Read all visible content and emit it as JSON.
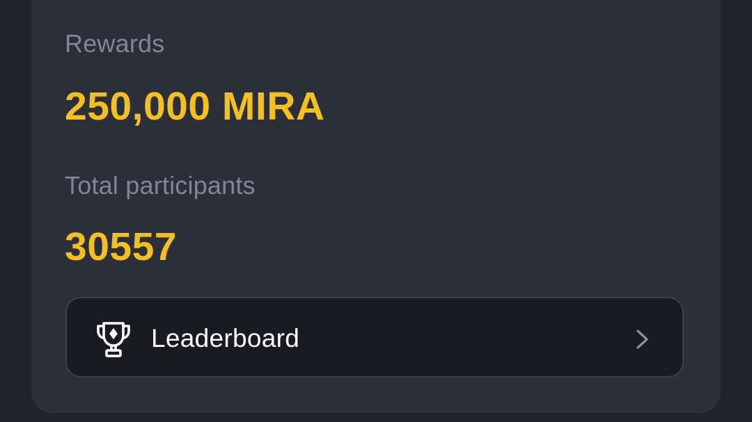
{
  "rewards": {
    "label": "Rewards",
    "value": "250,000 MIRA"
  },
  "participants": {
    "label": "Total participants",
    "value": "30557"
  },
  "leaderboard": {
    "label": "Leaderboard",
    "icon": "trophy-icon",
    "arrow_icon": "chevron-right-icon"
  },
  "colors": {
    "background": "#1f232b",
    "card": "#2a2f3a",
    "accent": "#f5c01a",
    "muted_text": "#7f8794",
    "button_bg": "#1a1b20"
  }
}
